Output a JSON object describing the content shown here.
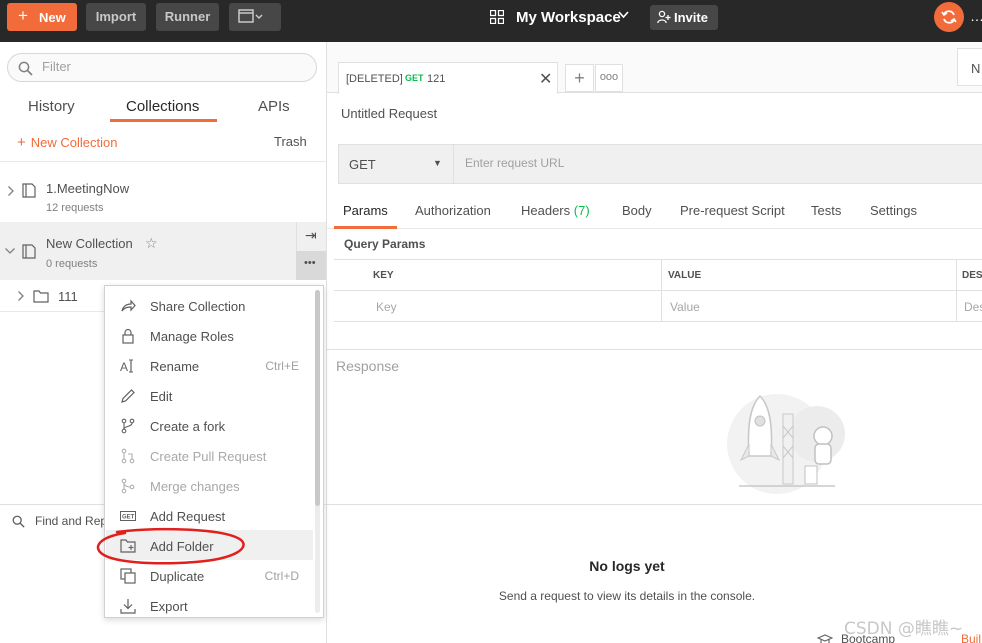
{
  "topbar": {
    "new_label": "New",
    "import_label": "Import",
    "runner_label": "Runner",
    "workspace_label": "My Workspace",
    "invite_label": "Invite",
    "right_edge": "…"
  },
  "sidebar": {
    "filter_placeholder": "Filter",
    "tabs": {
      "history": "History",
      "collections": "Collections",
      "apis": "APIs"
    },
    "new_collection": "New Collection",
    "trash": "Trash",
    "collections": [
      {
        "name": "1.MeetingNow",
        "sub": "12 requests"
      },
      {
        "name": "New Collection",
        "sub": "0 requests"
      }
    ],
    "folder_name": "111",
    "find_replace": "Find and Rep"
  },
  "context_menu": {
    "items": [
      {
        "label": "Share Collection",
        "shortcut": ""
      },
      {
        "label": "Manage Roles",
        "shortcut": ""
      },
      {
        "label": "Rename",
        "shortcut": "Ctrl+E"
      },
      {
        "label": "Edit",
        "shortcut": ""
      },
      {
        "label": "Create a fork",
        "shortcut": ""
      },
      {
        "label": "Create Pull Request",
        "shortcut": ""
      },
      {
        "label": "Merge changes",
        "shortcut": ""
      },
      {
        "label": "Add Request",
        "shortcut": ""
      },
      {
        "label": "Add Folder",
        "shortcut": ""
      },
      {
        "label": "Duplicate",
        "shortcut": "Ctrl+D"
      },
      {
        "label": "Export",
        "shortcut": ""
      }
    ]
  },
  "main": {
    "tab": {
      "deleted": "[DELETED]",
      "method": "GET",
      "name": "121"
    },
    "env_label": "N",
    "request_title": "Untitled Request",
    "method": "GET",
    "url_placeholder": "Enter request URL",
    "req_tabs": {
      "params": "Params",
      "authorization": "Authorization",
      "headers": "Headers",
      "headers_count": "(7)",
      "body": "Body",
      "prerequest": "Pre-request Script",
      "tests": "Tests",
      "settings": "Settings"
    },
    "query_params": "Query Params",
    "table": {
      "headers": [
        "KEY",
        "VALUE",
        "DESC"
      ],
      "placeholders": [
        "Key",
        "Value",
        "Des"
      ]
    },
    "response_label": "Response",
    "console": {
      "title": "No logs yet",
      "subtitle": "Send a request to view its details in the console."
    },
    "footer": {
      "bootcamp": "Bootcamp",
      "build": "Buil"
    }
  },
  "watermark": "CSDN @瞧瞧~",
  "colors": {
    "accent": "#f26b3a",
    "topbar": "#282828",
    "get_green": "#0cbb52"
  }
}
